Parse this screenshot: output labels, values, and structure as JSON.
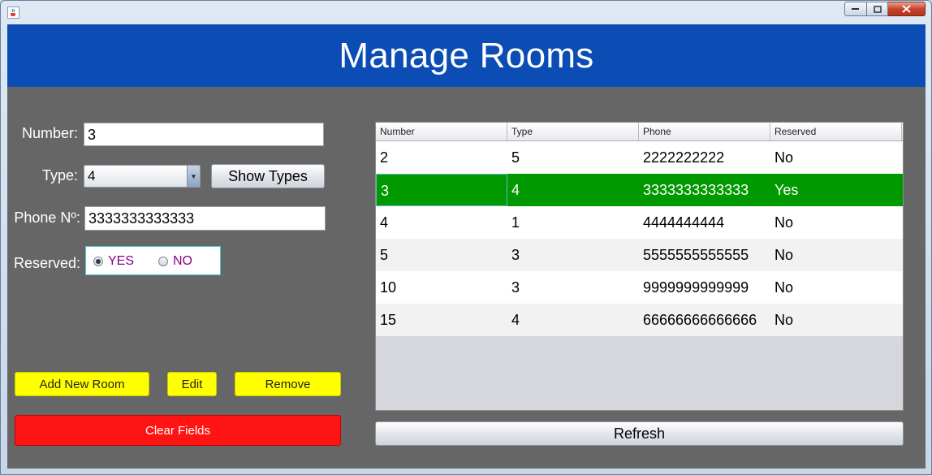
{
  "header": {
    "title": "Manage Rooms"
  },
  "form": {
    "number_label": "Number:",
    "number_value": "3",
    "type_label": "Type:",
    "type_value": "4",
    "show_types_label": "Show Types",
    "phone_label": "Phone Nº:",
    "phone_value": "3333333333333",
    "reserved_label": "Reserved:",
    "reserved_yes": "YES",
    "reserved_no": "NO",
    "reserved_selected": "YES"
  },
  "actions": {
    "add_label": "Add New Room",
    "edit_label": "Edit",
    "remove_label": "Remove",
    "clear_label": "Clear Fields",
    "refresh_label": "Refresh"
  },
  "table": {
    "columns": [
      "Number",
      "Type",
      "Phone",
      "Reserved"
    ],
    "rows": [
      [
        "2",
        "5",
        "2222222222",
        "No"
      ],
      [
        "3",
        "4",
        "3333333333333",
        "Yes"
      ],
      [
        "4",
        "1",
        "4444444444",
        "No"
      ],
      [
        "5",
        "3",
        "5555555555555",
        "No"
      ],
      [
        "10",
        "3",
        "9999999999999",
        "No"
      ],
      [
        "15",
        "4",
        "66666666666666",
        "No"
      ]
    ],
    "selected_row": 1
  },
  "colors": {
    "header": "#0b4db5",
    "panel": "#666666",
    "selected_row": "#009900",
    "yellow_button": "#ffff00",
    "red_button": "#ff1414"
  },
  "icons": {
    "app": "java-coffee-icon",
    "minimize": "minimize-icon",
    "maximize": "maximize-icon",
    "close": "close-icon",
    "dropdown": "chevron-down-icon"
  }
}
